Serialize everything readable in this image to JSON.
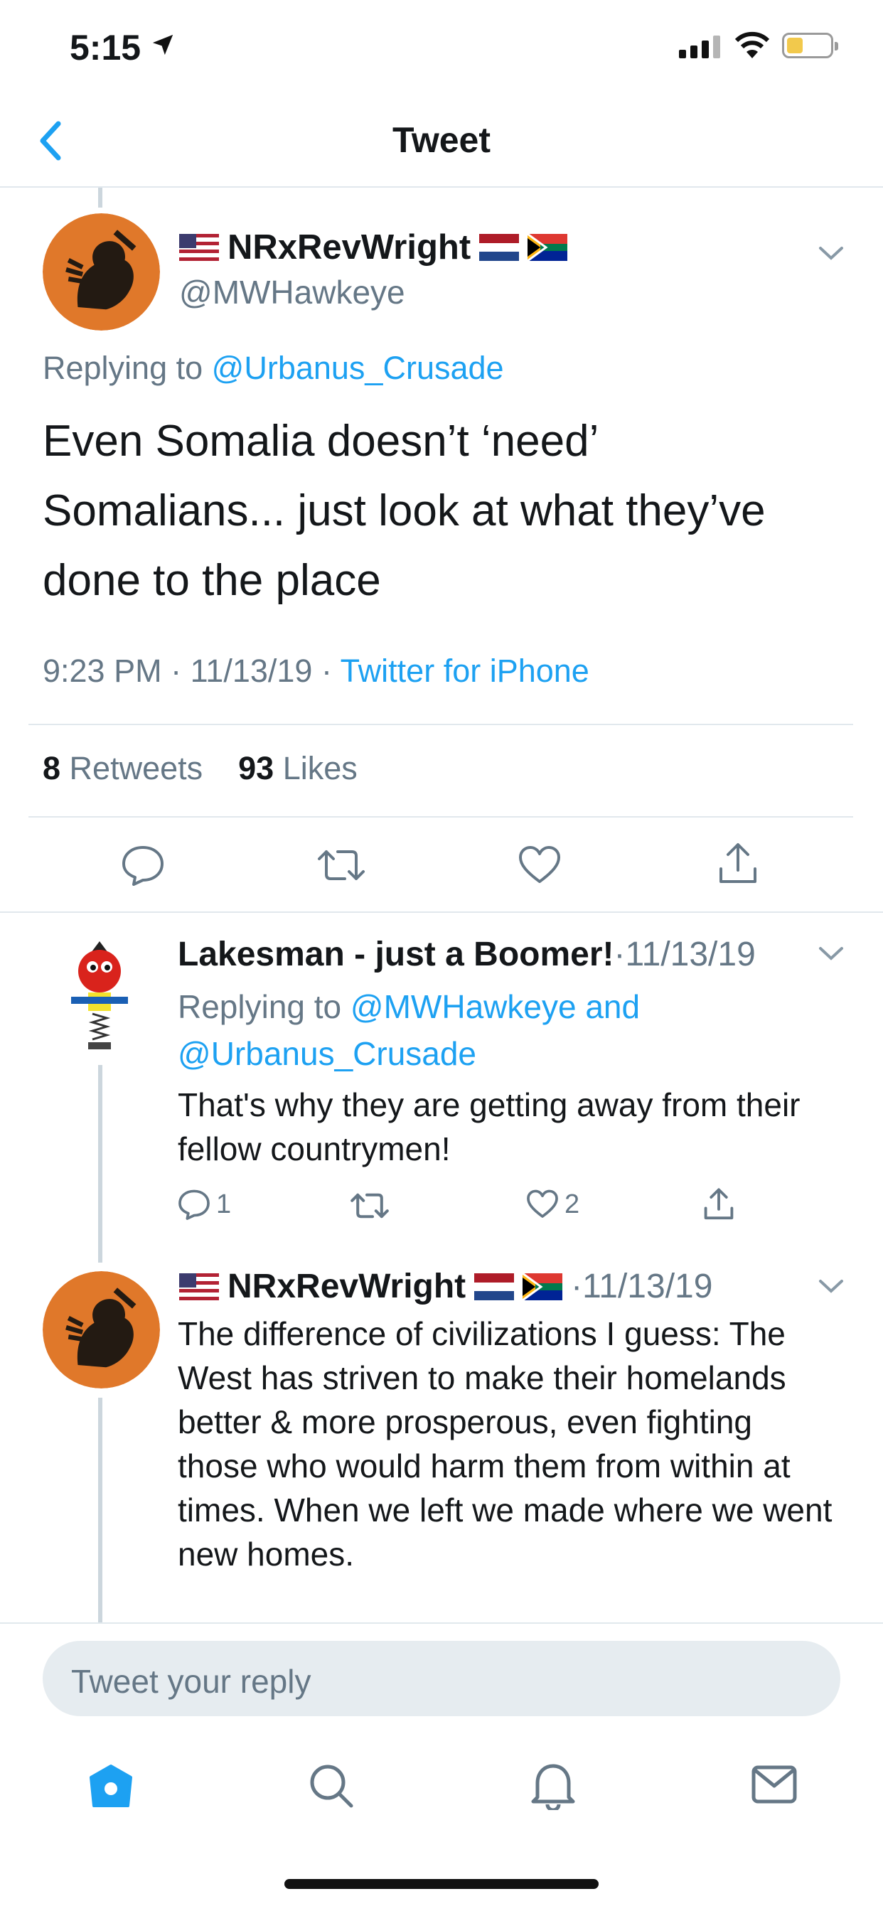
{
  "status_bar": {
    "time": "5:15"
  },
  "nav": {
    "title": "Tweet"
  },
  "main_tweet": {
    "display_name": "NRxRevWright",
    "handle": "@MWHawkeye",
    "replying_prefix": "Replying to",
    "replying_to": "@Urbanus_Crusade",
    "text": "Even Somalia doesn’t ‘need’ Somalians... just look at what they’ve done to the place",
    "time": "9:23 PM",
    "date": "11/13/19",
    "source": "Twitter for iPhone",
    "sep": "·",
    "retweets_count": "8",
    "retweets_label": "Retweets",
    "likes_count": "93",
    "likes_label": "Likes"
  },
  "replies": [
    {
      "display_name": "Lakesman - just a Boomer!",
      "date": "·11/13/19",
      "replying_prefix": "Replying to",
      "replying_to_1": "@MWHawkeye and",
      "replying_to_2": "@Urbanus_Crusade",
      "text": "That's why they are getting away from their fellow countrymen!",
      "reply_count": "1",
      "like_count": "2"
    },
    {
      "display_name": "NRxRevWright",
      "date": "·11/13/19",
      "text": "The difference of civilizations I guess: The West has striven to make their homelands better & more prosperous, even fighting those who would harm them from within at times. When we left we made where we went new homes."
    }
  ],
  "composer": {
    "placeholder": "Tweet your reply"
  },
  "tab_bar": {
    "tabs": [
      "home",
      "search",
      "notifications",
      "messages"
    ]
  },
  "colors": {
    "accent": "#1da1f2",
    "secondary_text": "#657786",
    "avatar_orange": "#e0782a"
  }
}
